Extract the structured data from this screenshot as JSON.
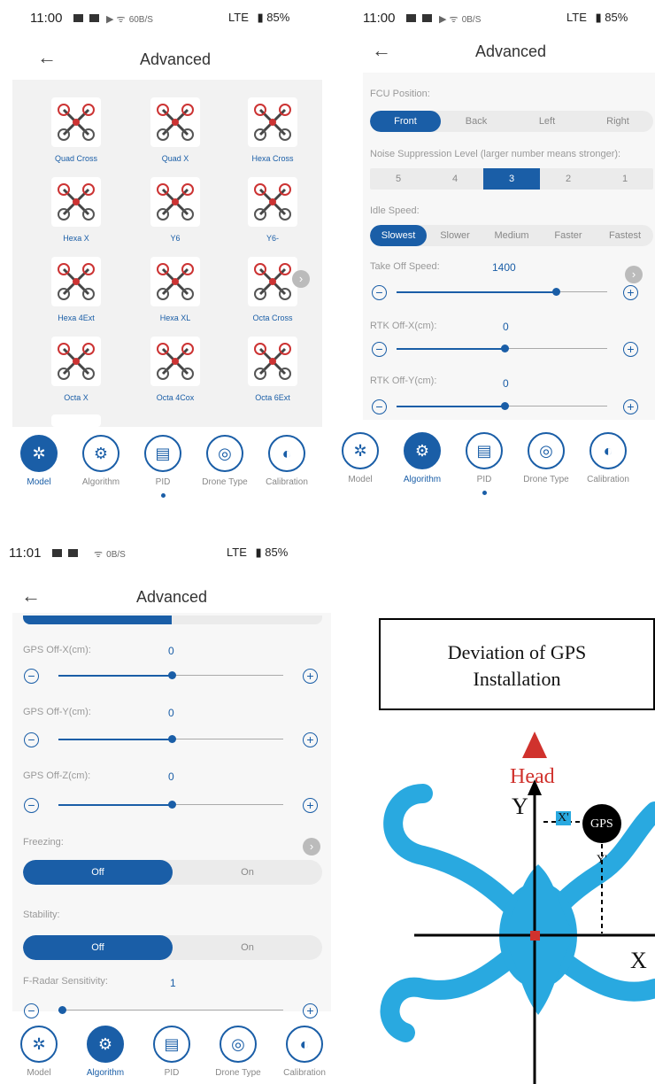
{
  "screen1": {
    "status": {
      "time": "11:00",
      "net": "60B/S",
      "right": "LTE",
      "battery": "85%"
    },
    "title": "Advanced",
    "models": [
      "Quad Cross",
      "Quad X",
      "Hexa Cross",
      "Hexa X",
      "Y6",
      "Y6-",
      "Hexa 4Ext",
      "Hexa XL",
      "Octa Cross",
      "Octa X",
      "Octa 4Cox",
      "Octa 6Ext"
    ],
    "nav": {
      "active": 0
    }
  },
  "screen2": {
    "status": {
      "time": "11:00",
      "net": "0B/S",
      "right": "LTE",
      "battery": "85%"
    },
    "title": "Advanced",
    "fcu_label": "FCU Position:",
    "fcu_options": [
      "Front",
      "Back",
      "Left",
      "Right"
    ],
    "noise_label": "Noise Suppression Level (larger number means stronger):",
    "noise_options": [
      "5",
      "4",
      "3",
      "2",
      "1"
    ],
    "idle_label": "Idle Speed:",
    "idle_options": [
      "Slowest",
      "Slower",
      "Medium",
      "Faster",
      "Fastest"
    ],
    "takeoff_label": "Take Off Speed:",
    "takeoff_value": "1400",
    "rtkx_label": "RTK Off-X(cm):",
    "rtkx_value": "0",
    "rtky_label": "RTK Off-Y(cm):",
    "rtky_value": "0",
    "nav": {
      "active": 1
    }
  },
  "screen3": {
    "status": {
      "time": "11:01",
      "net": "0B/S",
      "right": "LTE",
      "battery": "85%"
    },
    "title": "Advanced",
    "gpsx_label": "GPS Off-X(cm):",
    "gpsx_value": "0",
    "gpsy_label": "GPS Off-Y(cm):",
    "gpsy_value": "0",
    "gpsz_label": "GPS Off-Z(cm):",
    "gpsz_value": "0",
    "freezing_label": "Freezing:",
    "freezing_options": [
      "Off",
      "On"
    ],
    "stability_label": "Stability:",
    "stability_options": [
      "Off",
      "On"
    ],
    "radar_label": "F-Radar Sensitivity:",
    "radar_value": "1",
    "nav": {
      "active": 1
    }
  },
  "nav_labels": [
    "Model",
    "Algorithm",
    "PID",
    "Drone Type",
    "Calibration"
  ],
  "diagram": {
    "title_line1": "Deviation of GPS",
    "title_line2": "Installation",
    "head": "Head",
    "y_axis": "Y",
    "x_axis": "X",
    "gps": "GPS",
    "x_offset": "X'",
    "y_offset": "Y'"
  },
  "colors": {
    "accent": "#1a5ea7",
    "drone_blue": "#29a9e0",
    "head_red": "#d0322d"
  }
}
